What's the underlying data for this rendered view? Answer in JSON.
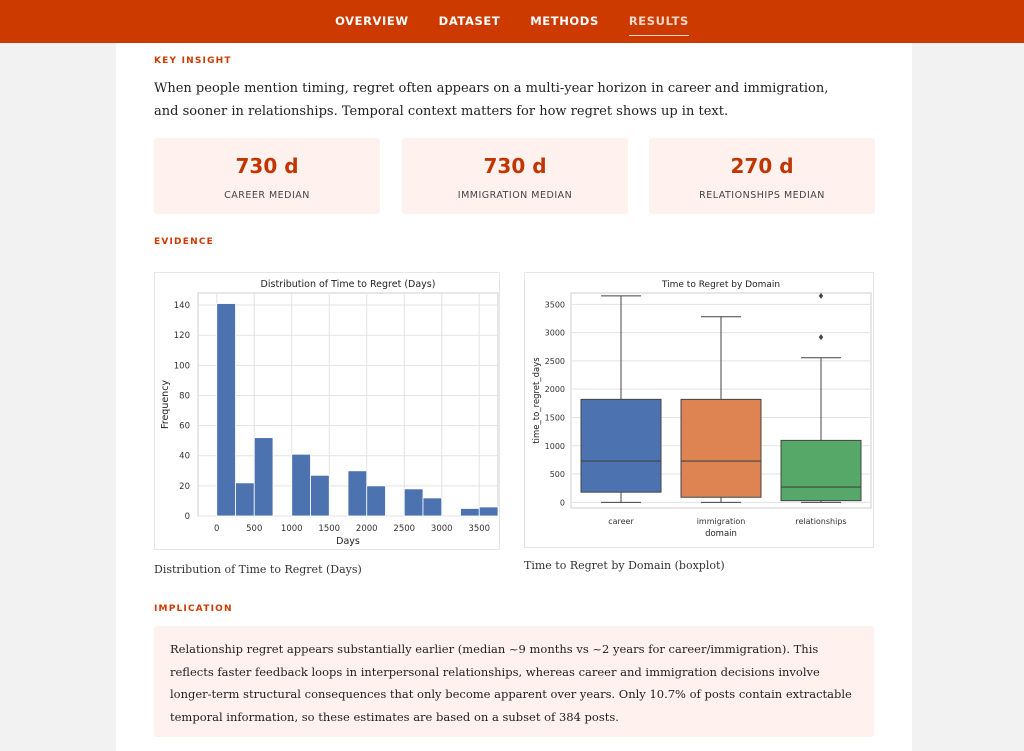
{
  "nav": {
    "items": [
      {
        "label": "OVERVIEW"
      },
      {
        "label": "DATASET"
      },
      {
        "label": "METHODS"
      },
      {
        "label": "RESULTS"
      }
    ],
    "active": "RESULTS"
  },
  "key_insight": {
    "label": "KEY INSIGHT",
    "text": "When people mention timing, regret often appears on a multi-year horizon in career and immigration, and sooner in relationships. Temporal context matters for how regret shows up in text."
  },
  "stats": [
    {
      "value": "730 d",
      "label": "CAREER MEDIAN"
    },
    {
      "value": "730 d",
      "label": "IMMIGRATION MEDIAN"
    },
    {
      "value": "270 d",
      "label": "RELATIONSHIPS MEDIAN"
    }
  ],
  "evidence": {
    "label": "EVIDENCE",
    "hist_caption": "Distribution of Time to Regret (Days)",
    "box_caption": "Time to Regret by Domain (boxplot)"
  },
  "implication": {
    "label": "IMPLICATION",
    "text": "Relationship regret appears substantially earlier (median ~9 months vs ~2 years for career/immigration). This reflects faster feedback loops in interpersonal relationships, whereas career and immigration decisions involve longer-term structural consequences that only become apparent over years. Only 10.7% of posts contain extractable temporal information, so these estimates are based on a subset of 384 posts."
  },
  "colors": {
    "accent": "#cc3a00",
    "bar": "#4c72b0",
    "career": "#4c72b0",
    "immigration": "#dd8452",
    "relationships": "#55a868"
  },
  "chart_data": [
    {
      "type": "bar",
      "title": "Distribution of Time to Regret (Days)",
      "xlabel": "Days",
      "ylabel": "Frequency",
      "xlim": [
        -250,
        3750
      ],
      "ylim": [
        0,
        148
      ],
      "xticks": [
        0,
        500,
        1000,
        1500,
        2000,
        2500,
        3000,
        3500
      ],
      "yticks": [
        0,
        20,
        40,
        60,
        80,
        100,
        120,
        140
      ],
      "grid": true,
      "bins": [
        {
          "x0": 0,
          "x1": 250,
          "count": 141
        },
        {
          "x0": 250,
          "x1": 500,
          "count": 22
        },
        {
          "x0": 500,
          "x1": 750,
          "count": 52
        },
        {
          "x0": 750,
          "x1": 1000,
          "count": 0
        },
        {
          "x0": 1000,
          "x1": 1250,
          "count": 41
        },
        {
          "x0": 1250,
          "x1": 1500,
          "count": 27
        },
        {
          "x0": 1500,
          "x1": 1750,
          "count": 0
        },
        {
          "x0": 1750,
          "x1": 2000,
          "count": 30
        },
        {
          "x0": 2000,
          "x1": 2250,
          "count": 20
        },
        {
          "x0": 2250,
          "x1": 2500,
          "count": 0
        },
        {
          "x0": 2500,
          "x1": 2750,
          "count": 18
        },
        {
          "x0": 2750,
          "x1": 3000,
          "count": 12
        },
        {
          "x0": 3000,
          "x1": 3250,
          "count": 0
        },
        {
          "x0": 3250,
          "x1": 3500,
          "count": 5
        },
        {
          "x0": 3500,
          "x1": 3750,
          "count": 6
        }
      ]
    },
    {
      "type": "box",
      "title": "Time to Regret by Domain",
      "xlabel": "domain",
      "ylabel": "time_to_regret_days",
      "ylim": [
        -100,
        3700
      ],
      "yticks": [
        0,
        500,
        1000,
        1500,
        2000,
        2500,
        3000,
        3500
      ],
      "grid": true,
      "categories": [
        "career",
        "immigration",
        "relationships"
      ],
      "boxes": [
        {
          "name": "career",
          "min": 0,
          "q1": 180,
          "median": 730,
          "q3": 1820,
          "max": 3650,
          "outliers": []
        },
        {
          "name": "immigration",
          "min": 0,
          "q1": 90,
          "median": 730,
          "q3": 1820,
          "max": 3280,
          "outliers": []
        },
        {
          "name": "relationships",
          "min": 0,
          "q1": 30,
          "median": 270,
          "q3": 1095,
          "max": 2555,
          "outliers": [
            2920,
            3650
          ]
        }
      ]
    }
  ]
}
